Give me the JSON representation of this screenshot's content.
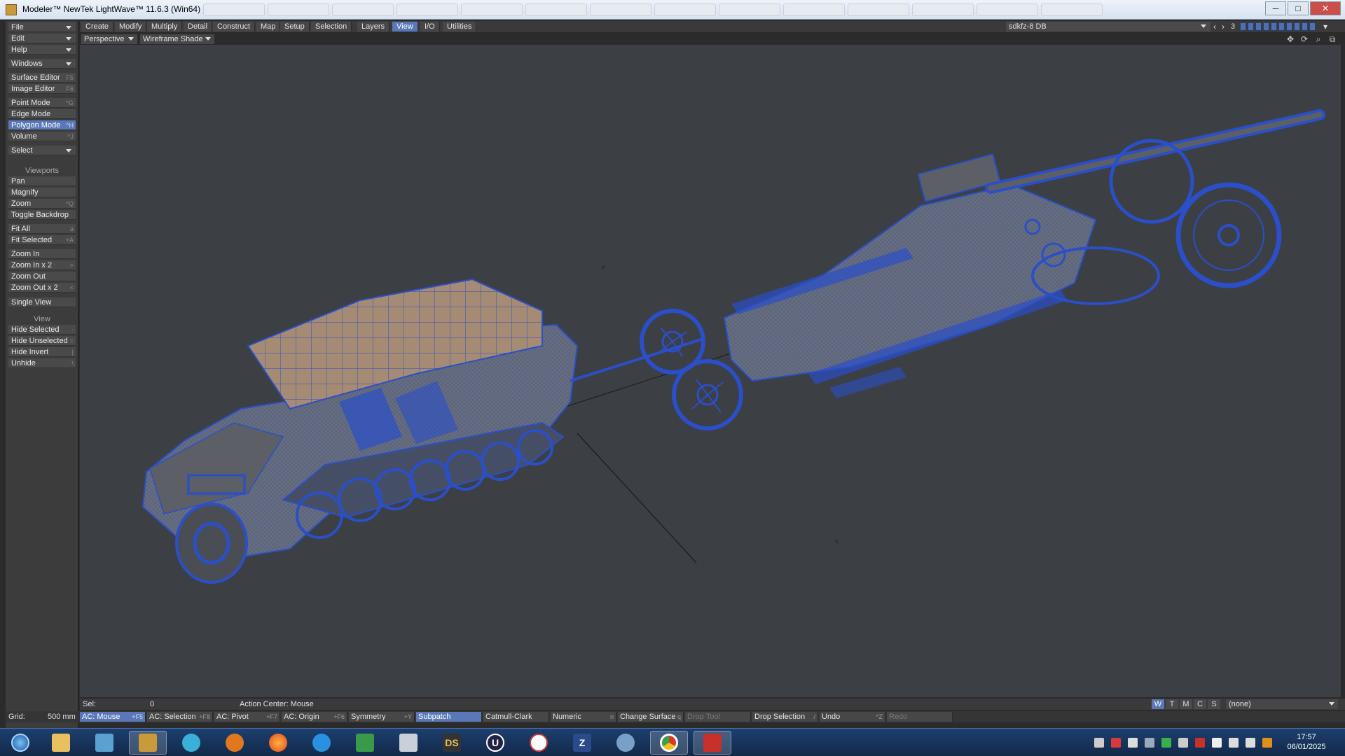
{
  "window": {
    "title": "Modeler™ NewTek LightWave™ 11.6.3 (Win64)",
    "minimize": "─",
    "maximize": "□",
    "close": "✕"
  },
  "left_panel": {
    "top_menus": [
      {
        "label": "File"
      },
      {
        "label": "Edit"
      },
      {
        "label": "Help"
      },
      {
        "label": "Windows"
      }
    ],
    "editors": [
      {
        "label": "Surface Editor",
        "shortcut": "F5"
      },
      {
        "label": "Image Editor",
        "shortcut": "F6"
      }
    ],
    "modes": [
      {
        "label": "Point Mode",
        "shortcut": "^G"
      },
      {
        "label": "Edge Mode",
        "shortcut": ""
      },
      {
        "label": "Polygon Mode",
        "shortcut": "^H"
      },
      {
        "label": "Volume",
        "shortcut": "^J"
      }
    ],
    "select_label": "Select",
    "viewports_header": "Viewports",
    "viewport_tools": [
      {
        "label": "Pan",
        "shortcut": ""
      },
      {
        "label": "Magnify",
        "shortcut": ""
      },
      {
        "label": "Zoom",
        "shortcut": "^Q"
      },
      {
        "label": "Toggle Backdrop",
        "shortcut": ""
      }
    ],
    "fit_tools": [
      {
        "label": "Fit All",
        "shortcut": "a"
      },
      {
        "label": "Fit Selected",
        "shortcut": "+A"
      }
    ],
    "zoom_tools": [
      {
        "label": "Zoom In",
        "shortcut": ""
      },
      {
        "label": "Zoom In x 2",
        "shortcut": ">"
      },
      {
        "label": "Zoom Out",
        "shortcut": ""
      },
      {
        "label": "Zoom Out x 2",
        "shortcut": "<"
      }
    ],
    "single_view": "Single View",
    "view_header": "View",
    "view_tools": [
      {
        "label": "Hide Selected",
        "shortcut": "-"
      },
      {
        "label": "Hide Unselected",
        "shortcut": "="
      },
      {
        "label": "Hide Invert",
        "shortcut": "|"
      },
      {
        "label": "Unhide",
        "shortcut": "\\"
      }
    ]
  },
  "menubar": {
    "tabs": [
      "Create",
      "Modify",
      "Multiply",
      "Detail",
      "Construct",
      "Map",
      "Setup",
      "Selection",
      "Layers",
      "View",
      "I/O",
      "Utilities"
    ],
    "active_tab": "View",
    "object_name": "sdkfz-8 DB",
    "layer_number": "3"
  },
  "viewport": {
    "projection": "Perspective",
    "shading": "Wireframe Shade"
  },
  "status": {
    "sel_label": "Sel:",
    "sel_value": "0",
    "action_center": "Action Center:  Mouse",
    "view_buttons": [
      "W",
      "T",
      "M",
      "C",
      "S"
    ],
    "active_view_button": "W",
    "surface_dropdown": "(none)"
  },
  "toolbar_bottom": {
    "grid_label": "Grid:",
    "grid_value": "500 mm",
    "items": [
      {
        "label": "AC: Mouse",
        "shortcut": "+F5",
        "active": true
      },
      {
        "label": "AC: Selection",
        "shortcut": "+F8"
      },
      {
        "label": "AC: Pivot",
        "shortcut": "+F7"
      },
      {
        "label": "AC: Origin",
        "shortcut": "+F6"
      },
      {
        "label": "Symmetry",
        "shortcut": "+Y"
      },
      {
        "label": "Subpatch",
        "shortcut": "",
        "active": true
      },
      {
        "label": "Catmull-Clark",
        "shortcut": ""
      },
      {
        "label": "Numeric",
        "shortcut": "n"
      },
      {
        "label": "Change Surface",
        "shortcut": "q"
      },
      {
        "label": "Drop Tool",
        "shortcut": "",
        "dim": true
      },
      {
        "label": "Drop Selection",
        "shortcut": "/"
      },
      {
        "label": "Undo",
        "shortcut": "^Z"
      },
      {
        "label": "Redo",
        "shortcut": "",
        "dim": true
      }
    ]
  },
  "taskbar": {
    "icons": [
      {
        "name": "start-orb-icon",
        "glyph": "",
        "color": "#3a8ad8"
      },
      {
        "name": "file-explorer-icon",
        "glyph": "",
        "color": "#e8c060"
      },
      {
        "name": "photos-app-icon",
        "glyph": "",
        "color": "#5aa0d0"
      },
      {
        "name": "lightwave-modeler-icon",
        "glyph": "",
        "color": "#c89a3a",
        "active": true
      },
      {
        "name": "spiral-app-icon",
        "glyph": "",
        "color": "#3ab0d8"
      },
      {
        "name": "blender-icon",
        "glyph": "",
        "color": "#e07820"
      },
      {
        "name": "firefox-icon",
        "glyph": "",
        "color": "#e86a20"
      },
      {
        "name": "blue-swirl-app-icon",
        "glyph": "",
        "color": "#2a90e0"
      },
      {
        "name": "spreadsheet-app-icon",
        "glyph": "",
        "color": "#3a9a4a"
      },
      {
        "name": "calculator-icon",
        "glyph": "",
        "color": "#c8d0d8"
      },
      {
        "name": "daz-studio-icon",
        "glyph": "DS",
        "color": "#333333"
      },
      {
        "name": "u-app-icon",
        "glyph": "U",
        "color": "#222244"
      },
      {
        "name": "vitruvian-app-icon",
        "glyph": "",
        "color": "#c83a3a"
      },
      {
        "name": "z-app-icon",
        "glyph": "Z",
        "color": "#2a4a8a"
      },
      {
        "name": "paint-brush-app-icon",
        "glyph": "",
        "color": "#7aa0c8"
      },
      {
        "name": "chrome-icon",
        "glyph": "",
        "color": "#3aa04a",
        "active": true
      },
      {
        "name": "red-app-icon",
        "glyph": "",
        "color": "#c8302a"
      }
    ],
    "time": "17:57",
    "date": "06/01/2025"
  },
  "colors": {
    "accent": "#5a78b8",
    "viewport_bg": "#3c3f44",
    "wire": "#2a4fc8",
    "model_fill": "#6b6e72",
    "canopy_fill": "#a58a74"
  }
}
